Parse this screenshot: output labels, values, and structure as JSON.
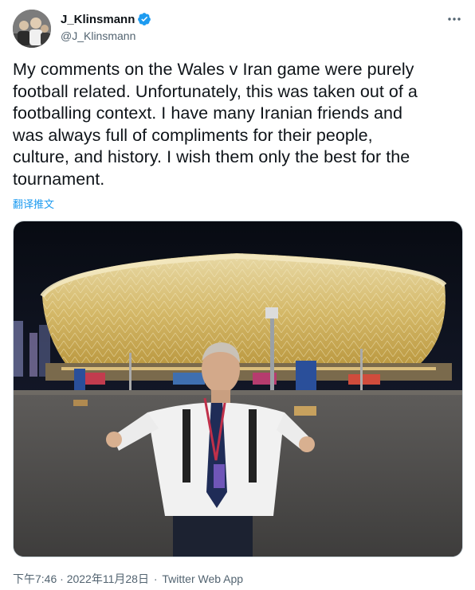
{
  "user": {
    "display_name": "J_Klinsmann",
    "handle": "@J_Klinsmann",
    "verified": true,
    "verified_color": "#1d9bf0"
  },
  "tweet": {
    "text": "My comments on the Wales v Iran game were purely\nfootball related. Unfortunately, this was taken out of a\nfootballing context. I have many Iranian friends and\nwas always full of compliments for their people,\nculture, and history. I wish them only the best for the\ntournament.",
    "translate_label": "翻译推文",
    "timestamp": "下午7:46 · 2022年11月28日",
    "separator": "·",
    "source": "Twitter Web App"
  },
  "icons": {
    "more": "more-options-icon",
    "verified": "verified-badge-icon"
  },
  "colors": {
    "text": "#0f1419",
    "secondary": "#536471",
    "link": "#1d9bf0"
  }
}
